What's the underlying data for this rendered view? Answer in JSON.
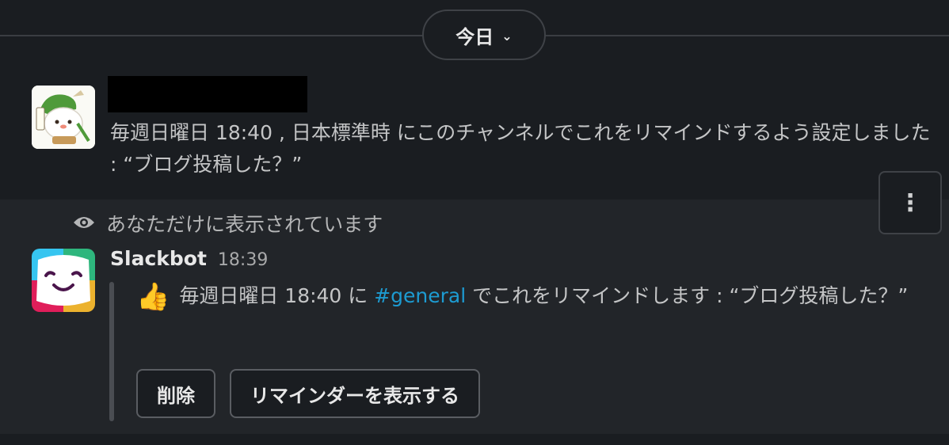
{
  "date_divider": {
    "label": "今日",
    "chevron": "⌄"
  },
  "message1": {
    "avatar_icon": "mascot-avatar-icon",
    "text": "毎週日曜日 18:40 , 日本標準時 にこのチャンネルでこれをリマインドするよう設定しました : “ブログ投稿した？”"
  },
  "more_actions": {
    "icon": "more-vertical-icon",
    "glyph": "⋮"
  },
  "ephemeral": {
    "note": "あなただけに表示されています",
    "icon": "eye-icon"
  },
  "message2": {
    "sender": "Slackbot",
    "time": "18:39",
    "emoji": "👍",
    "text_before": "毎週日曜日 18:40  に ",
    "channel": "#general",
    "text_after": " でこれをリマインドします : “ブログ投稿した？”",
    "buttons": {
      "delete": "削除",
      "show_reminders": "リマインダーを表示する"
    }
  },
  "colors": {
    "background": "#1a1d21",
    "ephemeral_bg": "#222529",
    "link": "#1d9bd1"
  }
}
